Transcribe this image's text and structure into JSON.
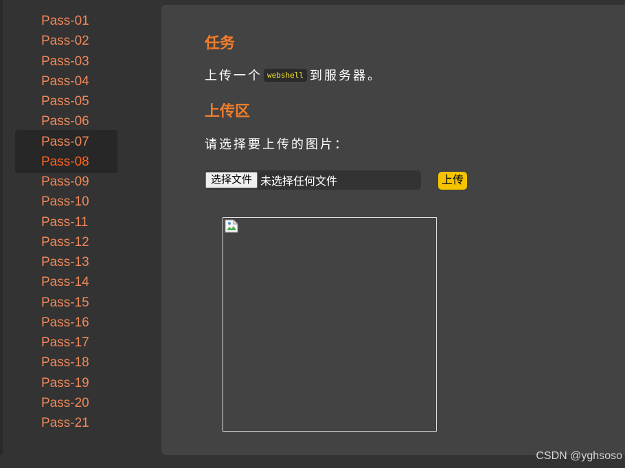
{
  "sidebar": {
    "items": [
      {
        "label": "Pass-01"
      },
      {
        "label": "Pass-02"
      },
      {
        "label": "Pass-03"
      },
      {
        "label": "Pass-04"
      },
      {
        "label": "Pass-05"
      },
      {
        "label": "Pass-06"
      },
      {
        "label": "Pass-07"
      },
      {
        "label": "Pass-08",
        "active": true
      },
      {
        "label": "Pass-09"
      },
      {
        "label": "Pass-10"
      },
      {
        "label": "Pass-11"
      },
      {
        "label": "Pass-12"
      },
      {
        "label": "Pass-13"
      },
      {
        "label": "Pass-14"
      },
      {
        "label": "Pass-15"
      },
      {
        "label": "Pass-16"
      },
      {
        "label": "Pass-17"
      },
      {
        "label": "Pass-18"
      },
      {
        "label": "Pass-19"
      },
      {
        "label": "Pass-20"
      },
      {
        "label": "Pass-21"
      }
    ]
  },
  "task": {
    "heading": "任务",
    "text_before": "上传一个",
    "code": "webshell",
    "text_after": "到服务器。"
  },
  "upload": {
    "heading": "上传区",
    "prompt": "请选择要上传的图片：",
    "choose_file_label": "选择文件",
    "no_file_text": "未选择任何文件",
    "submit_label": "上传"
  },
  "preview": {
    "icon": "broken-image-icon"
  },
  "watermark": "CSDN @yghsoso",
  "colors": {
    "link": "#f0885a",
    "link_active": "#ff6320",
    "heading": "#f07d2b",
    "upload_button": "#f5c400",
    "code_text": "#f5e62e",
    "panel_bg": "#434343",
    "page_bg": "#333333"
  }
}
